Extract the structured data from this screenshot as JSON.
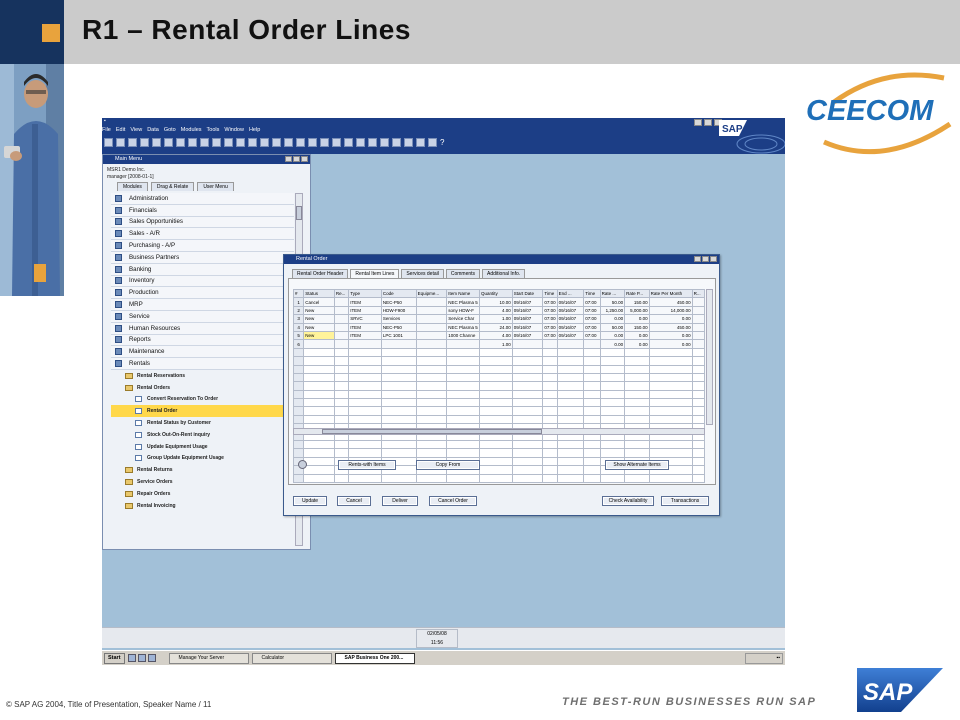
{
  "slide": {
    "title": "R1 – Rental Order Lines",
    "footer": "© SAP AG 2004, Title of Presentation, Speaker Name / 11",
    "tagline": "THE BEST-RUN BUSINESSES RUN SAP",
    "logo_ceecom": "CEECOM",
    "logo_sap": "SAP"
  },
  "app": {
    "menu": [
      "File",
      "Edit",
      "View",
      "Data",
      "Goto",
      "Modules",
      "Tools",
      "Window",
      "Help"
    ],
    "help_glyph": "?"
  },
  "main_menu": {
    "title": "Main Menu",
    "company": "MSR1 Demo Inc.",
    "user": "manager [2008-01-1]",
    "tabs": [
      "Modules",
      "Drag & Relate",
      "User Menu"
    ],
    "modules": [
      "Administration",
      "Financials",
      "Sales Opportunities",
      "Sales - A/R",
      "Purchasing - A/P",
      "Business Partners",
      "Banking",
      "Inventory",
      "Production",
      "MRP",
      "Service",
      "Human Resources",
      "Reports",
      "Maintenance",
      "Rentals"
    ],
    "rentals_tree": {
      "reservations": "Rental Reservations",
      "orders": "Rental Orders",
      "order_items": [
        "Convert Reservation To Order",
        "Rental Order",
        "Rental Status by Customer",
        "Stock Out-On-Rent inquiry",
        "Update Equipment Usage",
        "Group Update Equipment Usage"
      ],
      "selected": "Rental Order",
      "after": [
        "Rental Returns",
        "Service Orders",
        "Repair Orders",
        "Rental Invoicing"
      ]
    }
  },
  "rental_order": {
    "title": "Rental Order",
    "tabs": [
      "Rental Order Header",
      "Rental Item Lines",
      "Services detail",
      "Comments",
      "Additional Info."
    ],
    "active_tab": "Rental Item Lines",
    "columns": [
      "#",
      "Status",
      "Re...",
      "Type",
      "Code",
      "Equipme...",
      "Item Name",
      "Quantity",
      "Start Date",
      "Time",
      "End ...",
      "Time",
      "Rate ...",
      "Rate P...",
      "Rate Per Month",
      "R..."
    ],
    "rows": [
      {
        "n": "1",
        "status": "Cancel",
        "type": "ITEM",
        "code": "NEC-P50",
        "equip": "",
        "name": "NEC Plasma 5",
        "qty": "10.00",
        "start": "09/16/07",
        "t1": "07:00",
        "end": "09/16/07",
        "t2": "07:00",
        "r1": "50.00",
        "r2": "150.00",
        "rm": "450.00"
      },
      {
        "n": "2",
        "status": "New",
        "type": "ITEM",
        "code": "HDW-F900",
        "equip": "",
        "name": "sony HDW-F",
        "qty": "4.00",
        "start": "09/16/07",
        "t1": "07:00",
        "end": "09/16/07",
        "t2": "07:00",
        "r1": "1,250.00",
        "r2": "5,000.00",
        "rm": "14,000.00"
      },
      {
        "n": "3",
        "status": "New",
        "type": "SRVC",
        "code": "Services",
        "equip": "",
        "name": "Service Char",
        "qty": "1.00",
        "start": "09/16/07",
        "t1": "07:00",
        "end": "09/16/07",
        "t2": "07:00",
        "r1": "0.00",
        "r2": "0.00",
        "rm": "0.00"
      },
      {
        "n": "4",
        "status": "New",
        "type": "ITEM",
        "code": "NEC-P50",
        "equip": "",
        "name": "NEC Plasma 5",
        "qty": "24.00",
        "start": "09/16/07",
        "t1": "07:00",
        "end": "09/16/07",
        "t2": "07:00",
        "r1": "50.00",
        "r2": "150.00",
        "rm": "450.00"
      },
      {
        "n": "5",
        "status": "New",
        "type": "ITEM",
        "code": "LPC 1001",
        "equip": "",
        "name": "1000 Channe",
        "qty": "4.00",
        "start": "09/16/07",
        "t1": "07:00",
        "end": "09/16/07",
        "t2": "07:00",
        "r1": "0.00",
        "r2": "0.00",
        "rm": "0.00"
      },
      {
        "n": "6",
        "status": "",
        "type": "",
        "code": "",
        "equip": "",
        "name": "",
        "qty": "1.00",
        "start": "",
        "t1": "",
        "end": "",
        "t2": "",
        "r1": "0.00",
        "r2": "0.00",
        "rm": "0.00"
      }
    ],
    "empty_rows": 16,
    "buttons": {
      "rents_with": "Rents-with Items",
      "copy_from": "Copy From",
      "show_alt": "Show Alternate Items",
      "update": "Update",
      "cancel": "Cancel",
      "deliver": "Deliver",
      "cancel_order": "Cancel Order",
      "check_avail": "Check Availability",
      "transactions": "Transactions"
    }
  },
  "status_bar": {
    "date": "02/05/08",
    "time": "11:56"
  },
  "taskbar": {
    "start": "Start",
    "tasks": [
      "Manage Your Server",
      "Calculator",
      "SAP Business One 200..."
    ],
    "active": "SAP Business One 200..."
  },
  "colors": {
    "title_bar": "#1c3e86",
    "header_band": "#cbcbcb",
    "accent_orange": "#e8a33d",
    "selection": "#ffd84a",
    "desktop": "#a2c0d8"
  }
}
